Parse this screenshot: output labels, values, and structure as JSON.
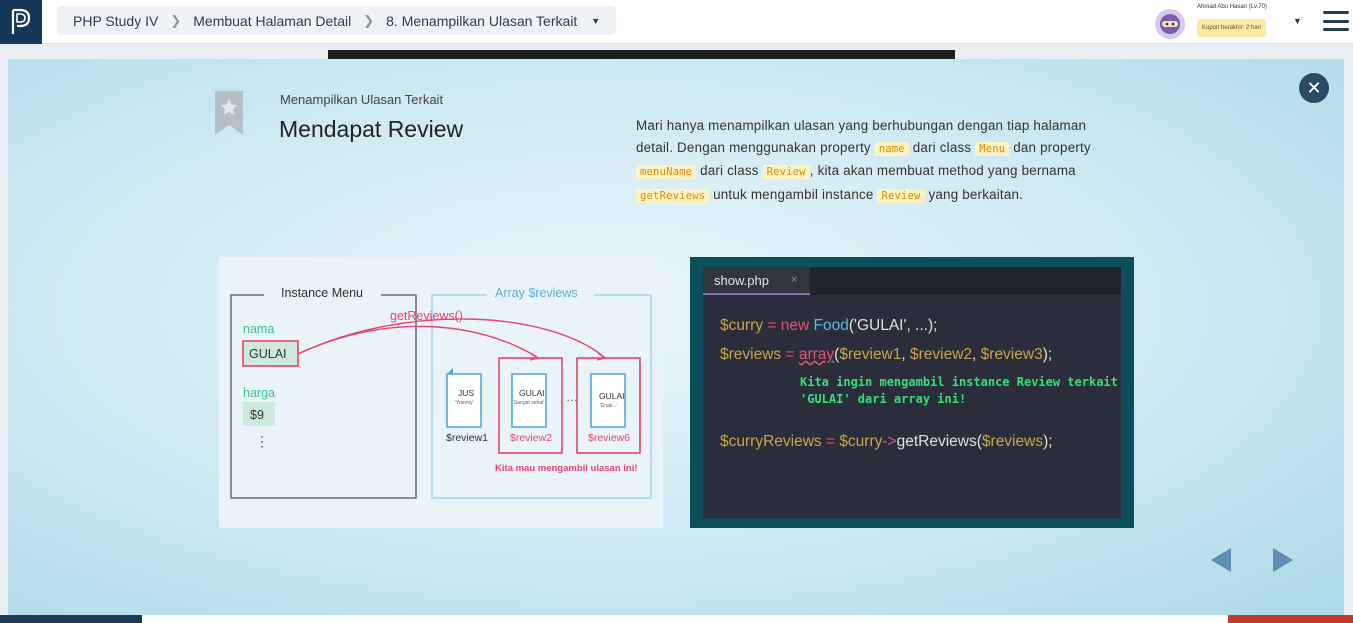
{
  "header": {
    "breadcrumb": [
      "PHP Study IV",
      "Membuat Halaman Detail",
      "8. Menampilkan Ulasan Terkait"
    ],
    "user_name": "Ahmad Abu Hasan (Lv.70)",
    "coupon": "Kupon berakhir: 2 hari"
  },
  "slide": {
    "subtitle": "Menampilkan Ulasan Terkait",
    "title": "Mendapat Review",
    "desc": {
      "t1": "Mari hanya menampilkan ulasan yang berhubungan dengan tiap halaman detail. Dengan menggunakan property ",
      "c1": "name",
      "t2": " dari class ",
      "c2": "Menu",
      "t3": " dan property ",
      "c3": "menuName",
      "t4": " dari class ",
      "c4": "Review",
      "t5": ", kita akan membuat method yang bernama ",
      "c5": "getReviews",
      "t6": " untuk mengambil instance ",
      "c6": "Review",
      "t7": " yang berkaitan."
    }
  },
  "diagram": {
    "instance_menu": "Instance Menu",
    "array_reviews": "Array $reviews",
    "get_reviews": "getReviews()",
    "nama": "nama",
    "gulai": "GULAI",
    "harga": "harga",
    "price": "$9",
    "vdots": "⋮",
    "doc1_title": "JUS",
    "doc1_sub": "'Yummy'",
    "doc2_title": "GULAI",
    "doc2_sub": "'Sangat sehat'",
    "ellipsis": "…",
    "doc3_title": "GULAI",
    "doc3_sub": "'Enak...'",
    "review1": "$review1",
    "review2": "$review2",
    "review6": "$review6",
    "note": "Kita mau mengambil ulasan ini!"
  },
  "code": {
    "tab": "show.php",
    "tab_close": "×",
    "l1": {
      "var": "$curry",
      "op": " = ",
      "kw": "new ",
      "cls": "Food",
      "rest": "('GULAI', ...);"
    },
    "l2": {
      "var": "$reviews",
      "op": " = ",
      "fn": "array",
      "p1": "(",
      "a1": "$review1",
      "c1": ", ",
      "a2": "$review2",
      "c2": ", ",
      "a3": "$review3",
      "end": ");"
    },
    "note1": "Kita ingin mengambil instance Review terkait",
    "note2": "'GULAI' dari array ini!",
    "l3": {
      "var": "$curryReviews",
      "op": " = ",
      "var2": "$curry",
      "arrow": "->",
      "fn": "getReviews",
      "p1": "(",
      "arg": "$reviews",
      "end": ");"
    }
  },
  "colors": {
    "accent_navy": "#2c4a62",
    "highlight_pink": "#e8436f",
    "label_green": "#3cc38a",
    "array_blue": "#5bb0dd"
  }
}
